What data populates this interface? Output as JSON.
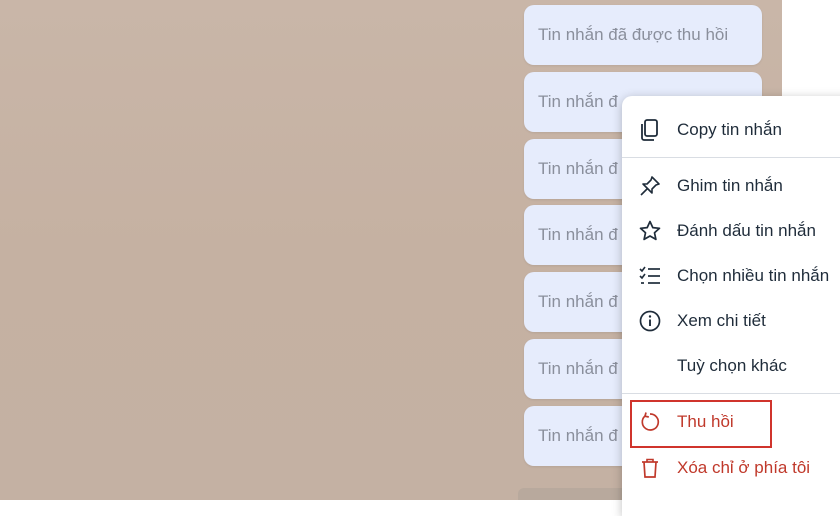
{
  "messages": [
    {
      "text": "Tin nhắn đã được thu hồi"
    },
    {
      "text": "Tin nhắn đ"
    },
    {
      "text": "Tin nhắn đ"
    },
    {
      "text": "Tin nhắn đ"
    },
    {
      "text": "Tin nhắn đ"
    },
    {
      "text": "Tin nhắn đ"
    },
    {
      "text": "Tin nhắn đ"
    }
  ],
  "context_menu": {
    "items": [
      {
        "label": "Copy tin nhắn",
        "icon": "copy-icon"
      },
      {
        "label": "Ghim tin nhắn",
        "icon": "pin-icon"
      },
      {
        "label": "Đánh dấu tin nhắn",
        "icon": "star-icon"
      },
      {
        "label": "Chọn nhiều tin nhắn",
        "icon": "checklist-icon"
      },
      {
        "label": "Xem chi tiết",
        "icon": "info-icon"
      },
      {
        "label": "Tuỳ chọn khác",
        "icon": ""
      },
      {
        "label": "Thu hồi",
        "icon": "recall-icon"
      },
      {
        "label": "Xóa chỉ ở phía tôi",
        "icon": "trash-icon"
      }
    ]
  },
  "colors": {
    "bubble_bg": "#e6ecfc",
    "danger": "#c0392b",
    "highlight_border": "#d0342c",
    "chat_bg": "#c7b4a6"
  }
}
